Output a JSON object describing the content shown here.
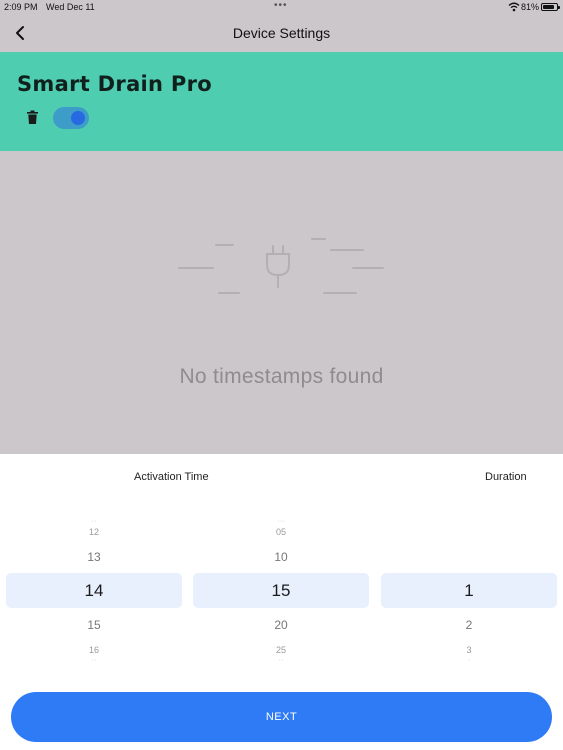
{
  "status_bar": {
    "time": "2:09 PM",
    "date": "Wed Dec 11",
    "battery": "81%"
  },
  "nav": {
    "title": "Device Settings",
    "back_icon": "chevron-left-icon"
  },
  "device": {
    "name": "Smart Drain Pro",
    "enabled": true,
    "toggle_color": "#2769e0"
  },
  "empty_state": {
    "icon": "plug-icon",
    "message": "No timestamps found"
  },
  "scheduler": {
    "activation_label": "Activation Time",
    "duration_label": "Duration",
    "hour": {
      "far_above": "12",
      "above": "13",
      "selected": "14",
      "below": "15",
      "far_below": "16"
    },
    "minute": {
      "far_above": "05",
      "above": "10",
      "selected": "15",
      "below": "20",
      "far_below": "25"
    },
    "duration": {
      "selected": "1",
      "below": "2",
      "far_below": "3"
    }
  },
  "next_label": "NEXT",
  "colors": {
    "header_bg": "#4fcdb0",
    "accent": "#2f7bf5",
    "selected_row_bg": "#e8f0fd"
  }
}
